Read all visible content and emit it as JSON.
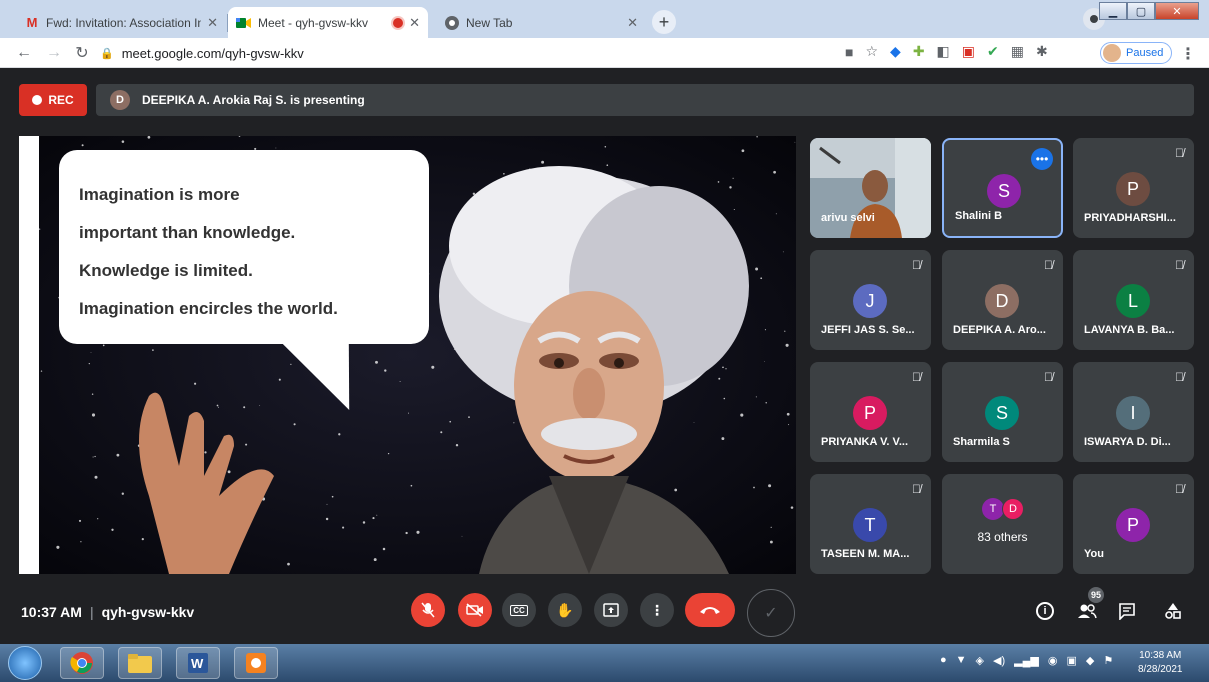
{
  "browser": {
    "tabs": [
      {
        "title": "Fwd: Invitation: Association Inaug",
        "icon": "gmail-icon",
        "active": false
      },
      {
        "title": "Meet - qyh-gvsw-kkv",
        "icon": "meet-icon",
        "active": true
      },
      {
        "title": "New Tab",
        "icon": "chrome-icon",
        "active": false
      }
    ],
    "url": "meet.google.com/qyh-gvsw-kkv",
    "profile_status": "Paused"
  },
  "meet": {
    "rec_label": "REC",
    "presenter_initial": "D",
    "presenter_text": "DEEPIKA A. Arokia Raj S. is presenting",
    "slide_lines": [
      "Imagination is more",
      "important than knowledge.",
      "Knowledge is limited.",
      "Imagination encircles the world."
    ],
    "tiles": [
      {
        "name": "arivu selvi",
        "initial": "",
        "color": "",
        "muted": false
      },
      {
        "name": "Shalini B",
        "initial": "S",
        "color": "#8e24aa",
        "muted": false
      },
      {
        "name": "PRIYADHARSHI...",
        "initial": "P",
        "color": "#6d4c41",
        "muted": true
      },
      {
        "name": "JEFFI JAS S. Se...",
        "initial": "J",
        "color": "#5c6bc0",
        "muted": true
      },
      {
        "name": "DEEPIKA A. Aro...",
        "initial": "D",
        "color": "#8d6e63",
        "muted": true
      },
      {
        "name": "LAVANYA B. Ba...",
        "initial": "L",
        "color": "#0b8043",
        "muted": true
      },
      {
        "name": "PRIYANKA V. V...",
        "initial": "P",
        "color": "#d81b60",
        "muted": true
      },
      {
        "name": "Sharmila S",
        "initial": "S",
        "color": "#00897b",
        "muted": true
      },
      {
        "name": "ISWARYA D. Di...",
        "initial": "I",
        "color": "#546e7a",
        "muted": true
      },
      {
        "name": "TASEEN M. MA...",
        "initial": "T",
        "color": "#3949ab",
        "muted": true
      },
      {
        "name": "83 others",
        "initial": "",
        "color": "",
        "muted": false
      },
      {
        "name": "You",
        "initial": "P",
        "color": "#8e24aa",
        "muted": true
      }
    ],
    "others_initials": [
      "T",
      "D"
    ],
    "others_colors": [
      "#8e24aa",
      "#e91e63"
    ],
    "time": "10:37 AM",
    "meeting_code": "qyh-gvsw-kkv",
    "participant_count": "95"
  },
  "taskbar": {
    "time": "10:38 AM",
    "date": "8/28/2021"
  }
}
